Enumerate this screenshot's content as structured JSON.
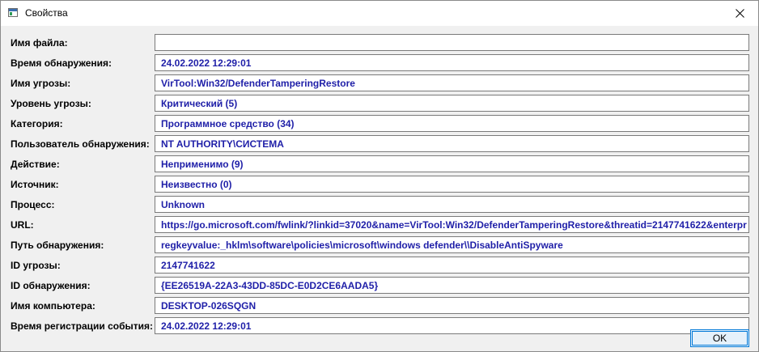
{
  "window": {
    "title": "Свойства",
    "app_icon": "properties-window-icon",
    "close_icon": "close-icon"
  },
  "fields": [
    {
      "label": "Имя файла:",
      "value": ""
    },
    {
      "label": "Время обнаружения:",
      "value": "24.02.2022 12:29:01"
    },
    {
      "label": "Имя угрозы:",
      "value": "VirTool:Win32/DefenderTamperingRestore"
    },
    {
      "label": "Уровень угрозы:",
      "value": "Критический (5)"
    },
    {
      "label": "Категория:",
      "value": "Программное средство (34)"
    },
    {
      "label": "Пользователь обнаружения:",
      "value": "NT AUTHORITY\\СИСТЕМА"
    },
    {
      "label": "Действие:",
      "value": "Неприменимо (9)"
    },
    {
      "label": "Источник:",
      "value": "Неизвестно (0)"
    },
    {
      "label": "Процесс:",
      "value": "Unknown"
    },
    {
      "label": "URL:",
      "value": "https://go.microsoft.com/fwlink/?linkid=37020&name=VirTool:Win32/DefenderTamperingRestore&threatid=2147741622&enterpr"
    },
    {
      "label": "Путь обнаружения:",
      "value": "regkeyvalue:_hklm\\software\\policies\\microsoft\\windows defender\\\\DisableAntiSpyware"
    },
    {
      "label": "ID угрозы:",
      "value": "2147741622"
    },
    {
      "label": "ID обнаружения:",
      "value": "{EE26519A-22A3-43DD-85DC-E0D2CE6AADA5}"
    },
    {
      "label": "Имя компьютера:",
      "value": "DESKTOP-026SQGN"
    },
    {
      "label": "Время регистрации события:",
      "value": "24.02.2022 12:29:01"
    }
  ],
  "buttons": {
    "ok_label": "OK"
  }
}
